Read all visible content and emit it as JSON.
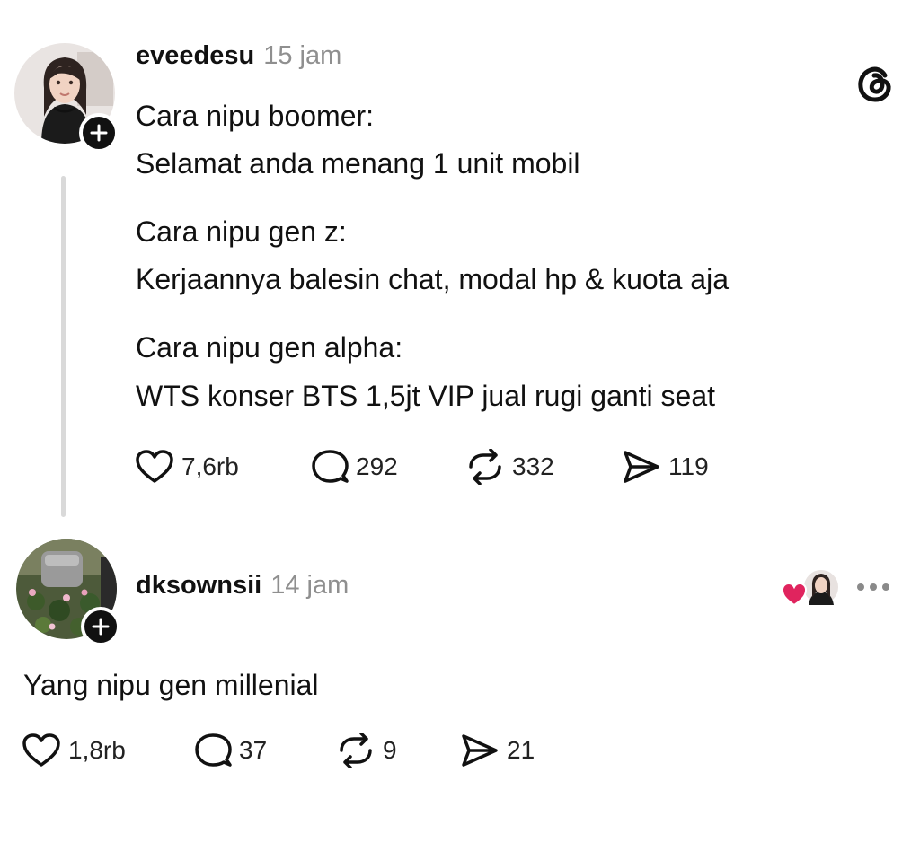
{
  "post1": {
    "username": "eveedesu",
    "time": "15 jam",
    "lines": [
      "Cara nipu boomer:",
      "Selamat anda menang 1 unit mobil",
      "Cara nipu gen z:",
      "Kerjaannya balesin chat, modal hp & kuota aja",
      "Cara nipu gen alpha:",
      "WTS konser BTS 1,5jt VIP jual rugi ganti seat"
    ],
    "stats": {
      "likes": "7,6rb",
      "replies": "292",
      "reposts": "332",
      "shares": "119"
    }
  },
  "post2": {
    "username": "dksownsii",
    "time": "14 jam",
    "text": "Yang nipu gen millenial",
    "stats": {
      "likes": "1,8rb",
      "replies": "37",
      "reposts": "9",
      "shares": "21"
    }
  },
  "icons": {
    "app_logo": "threads-logo-icon",
    "like": "heart-icon",
    "reply": "comment-bubble-icon",
    "repost": "repost-arrows-icon",
    "share": "send-icon",
    "follow": "plus-icon",
    "more": "more-dots-icon"
  },
  "colors": {
    "text": "#111111",
    "muted": "#8f8f8f",
    "thread_line": "#d9d9d9",
    "heart_red": "#e0245e"
  }
}
